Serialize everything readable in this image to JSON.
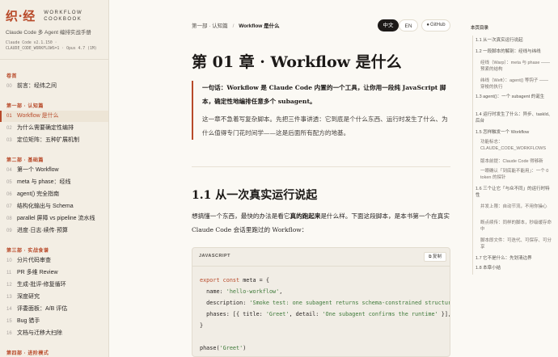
{
  "brand": {
    "logo": "织·经",
    "title_line1": "WORKFLOW",
    "title_line2": "COOKBOOK",
    "subtitle": "Claude Code 多 Agent 编排实战手册",
    "version_line1": "Claude Code v2.1.150 ·",
    "version_line2": "CLAUDE_CODE_WORKFLOWS=1 · Opus 4.7 (1M)"
  },
  "sidebar": {
    "sections": [
      {
        "label": "卷首",
        "items": [
          {
            "num": "00",
            "label": "前言：经纬之间"
          }
        ]
      },
      {
        "label": "第一部 · 认知篇",
        "items": [
          {
            "num": "01",
            "label": "Workflow 是什么",
            "active": true
          },
          {
            "num": "02",
            "label": "为什么需要确定性编排"
          },
          {
            "num": "03",
            "label": "定位矩阵：五种扩展机制"
          }
        ]
      },
      {
        "label": "第二部 · 基础篇",
        "items": [
          {
            "num": "04",
            "label": "第一个 Workflow"
          },
          {
            "num": "05",
            "label": "meta 与 phase：经线"
          },
          {
            "num": "06",
            "label": "agent() 完全指南"
          },
          {
            "num": "07",
            "label": "结构化输出与 Schema"
          },
          {
            "num": "08",
            "label": "parallel 屏障 vs pipeline 流水线"
          },
          {
            "num": "09",
            "label": "进度·日志·续传·预算"
          }
        ]
      },
      {
        "label": "第三部 · 实战食谱",
        "items": [
          {
            "num": "10",
            "label": "分片代码审查"
          },
          {
            "num": "11",
            "label": "PR 多维 Review"
          },
          {
            "num": "12",
            "label": "生成-批评-修复循环"
          },
          {
            "num": "13",
            "label": "深度研究"
          },
          {
            "num": "14",
            "label": "评委面板：A/B 评估"
          },
          {
            "num": "15",
            "label": "Bug 猎手"
          },
          {
            "num": "16",
            "label": "文档与迁移大扫除"
          }
        ]
      },
      {
        "label": "第四部 · 进阶模式",
        "items": []
      }
    ]
  },
  "topbar": {
    "breadcrumb_part": "第一部 · 认知篇",
    "breadcrumb_sep": "/",
    "breadcrumb_current": "Workflow 是什么",
    "lang_zh": "中文",
    "lang_en": "EN",
    "github": "GitHub"
  },
  "main": {
    "title": "第 01 章 · Workflow 是什么",
    "quote_p1": "一句话：Workflow 是 Claude Code 内置的一个工具，让你用一段纯 JavaScript 脚本，确定性地编排任意多个 subagent。",
    "quote_p2": "这一章不急着写复杂脚本。先把三件事讲透：它到底是个什么东西、运行时发生了什么、为什么值得专门花时间学——这是后面所有配方的地基。",
    "h2": "1.1 从一次真实运行说起",
    "para_a": "想搞懂一个东西，最快的办法是看它",
    "para_b": "真的跑起来",
    "para_c": "是什么样。下面这段脚本，是本书第一个在真实 Claude Code 会话里跑过的 Workflow：",
    "code_lang": "JAVASCRIPT",
    "copy_label": "复制"
  },
  "code_lines": [
    "export const meta = {",
    "  name: 'hello-workflow',",
    "  description: 'Smoke test: one subagent returns schema-constrained structured output',",
    "  phases: [{ title: 'Greet', detail: 'One subagent confirms the runtime' }],",
    "}",
    "",
    "phase('Greet')"
  ],
  "toc": {
    "title": "本页目录",
    "items": [
      {
        "label": "1.1 从一次真实运行说起",
        "sub": false
      },
      {
        "label": "1.2 一段脚本的解剖：经线与纬线",
        "sub": false
      },
      {
        "label": "经线（Warp）：meta 与 phase —— 预紧的结构",
        "sub": true
      },
      {
        "label": "纬线（Weft）：agent() 等钩子 —— 穿梭的执行",
        "sub": true
      },
      {
        "label": "1.3 agent()：一个 subagent 的诞生",
        "sub": false
      },
      {
        "label": "1.4 运行时发生了什么：异步、taskId、后台",
        "sub": false
      },
      {
        "label": "1.5 怎样触发一个 Workflow",
        "sub": false
      },
      {
        "label": "功能标志：CLAUDE_CODE_WORKFLOWS",
        "sub": true
      },
      {
        "label": "版本前提：Claude Code 得够新",
        "sub": true
      },
      {
        "label": "一眼确认「到底能不能用」：一个 0 token 的探针",
        "sub": true
      },
      {
        "label": "1.6 三个让它「与众不同」的运行时特性",
        "sub": false
      },
      {
        "label": "并发上限：自动节流，不用你操心",
        "sub": true
      },
      {
        "label": "断点续传：同样的脚本，秒级缓存命中",
        "sub": true
      },
      {
        "label": "脚本即文件：可迭代、可保存、可分享",
        "sub": true
      },
      {
        "label": "1.7 它不是什么：先划清边界",
        "sub": false
      },
      {
        "label": "1.8 本章小结",
        "sub": false
      }
    ]
  }
}
